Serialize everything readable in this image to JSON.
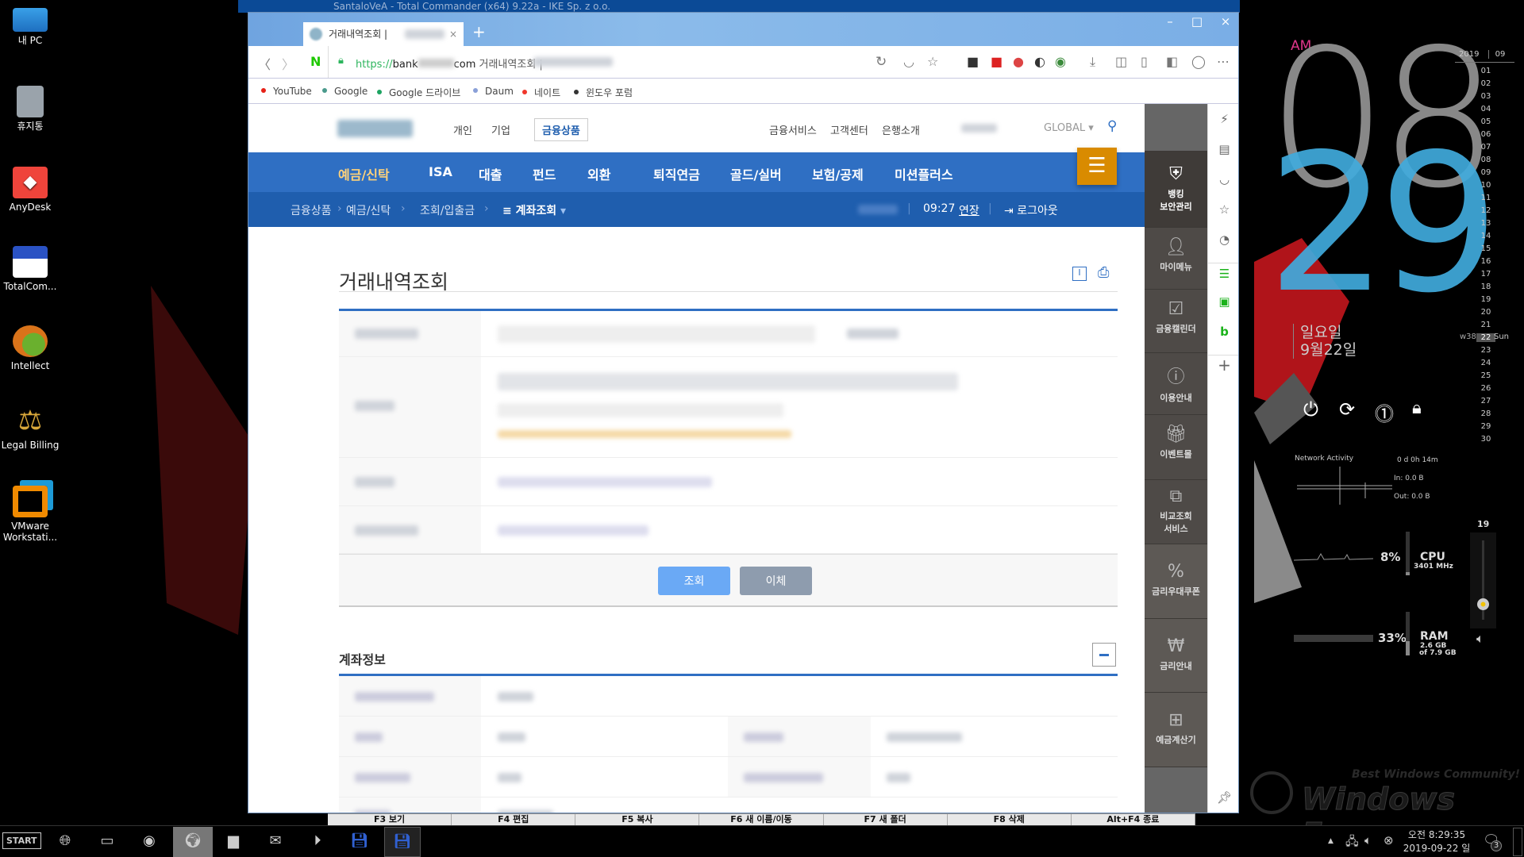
{
  "desktop": {
    "icons": [
      {
        "label": "내 PC",
        "icon": "computer-icon"
      },
      {
        "label": "휴지통",
        "icon": "recycle-bin-icon"
      },
      {
        "label": "AnyDesk",
        "icon": "anydesk-icon"
      },
      {
        "label": "TotalCom...",
        "icon": "floppy-icon"
      },
      {
        "label": "Intellect",
        "icon": "intellect-icon"
      },
      {
        "label": "Legal Billing",
        "icon": "scales-icon"
      },
      {
        "label": "VMware Workstati...",
        "icon": "vmware-icon"
      }
    ]
  },
  "background_window": {
    "title": "SantaloVeA - Total Commander (x64) 9.22a - IKE Sp. z o.o."
  },
  "browser": {
    "tab": {
      "title": "거래내역조회 |",
      "close": "×",
      "new_tab": "+"
    },
    "window_controls": {
      "minimize": "–",
      "maximize": "□",
      "close": "×"
    },
    "address": {
      "scheme": "https://",
      "host_prefix": "bank",
      "host_suffix": "com",
      "page_title": "거래내역조회 |"
    },
    "bookmarks": [
      {
        "label": "YouTube",
        "color": "#e62117"
      },
      {
        "label": "Google",
        "color": "#4a9a8c"
      },
      {
        "label": "Google 드라이브",
        "color": "#1da462"
      },
      {
        "label": "Daum",
        "color": "#8aa0d8"
      },
      {
        "label": "네이트",
        "color": "#f0362b"
      },
      {
        "label": "윈도우 포럼",
        "color": "#333333"
      }
    ]
  },
  "site": {
    "top_links": [
      "개인",
      "기업",
      "금융상품"
    ],
    "util_links": [
      "금융서비스",
      "고객센터",
      "은행소개"
    ],
    "global": "GLOBAL",
    "gnb": [
      "예금/신탁",
      "ISA",
      "대출",
      "펀드",
      "외환",
      "퇴직연금",
      "골드/실버",
      "보험/공제",
      "미션플러스"
    ],
    "breadcrumb": [
      "금융상품",
      "예금/신탁",
      "조회/입출금",
      "계좌조회"
    ],
    "session_time": "09:27",
    "extend": "연장",
    "logout": "로그아웃",
    "page_title": "거래내역조회",
    "buttons": {
      "search": "조회",
      "transfer": "이체"
    },
    "section_title": "계좌정보",
    "colors": {
      "gnb": "#2f6fc3",
      "breadcrumb": "#1f5eae",
      "active": "#ffd27a",
      "menu": "#d98b00"
    }
  },
  "side_menu": [
    {
      "label": "뱅킹\n보안관리",
      "icon": "shield-icon"
    },
    {
      "label": "마이메뉴",
      "icon": "user-icon"
    },
    {
      "label": "금융캘린더",
      "icon": "calendar-icon"
    },
    {
      "label": "이용안내",
      "icon": "info-icon"
    },
    {
      "label": "이벤트몰",
      "icon": "gift-icon"
    },
    {
      "label": "비교조회\n서비스",
      "icon": "compare-icon"
    },
    {
      "label": "금리우대쿠폰",
      "icon": "coupon-icon"
    },
    {
      "label": "금리안내",
      "icon": "won-icon"
    },
    {
      "label": "예금계산기",
      "icon": "calculator-icon"
    }
  ],
  "fkeys": [
    "F3 보기",
    "F4 편집",
    "F5 복사",
    "F6 새 이름/이동",
    "F7 새 폴더",
    "F8 삭제",
    "Alt+F4 종료"
  ],
  "clock_widget": {
    "ampm": "AM",
    "hour": "08",
    "minute": "29",
    "weekday": "일요일",
    "date": "9월22일"
  },
  "calendar": {
    "year": "2019",
    "month": "09",
    "days": [
      "01",
      "02",
      "03",
      "04",
      "05",
      "06",
      "07",
      "08",
      "09",
      "10",
      "11",
      "12",
      "13",
      "14",
      "15",
      "16",
      "17",
      "18",
      "19",
      "20",
      "21",
      "22",
      "23",
      "24",
      "25",
      "26",
      "27",
      "28",
      "29",
      "30"
    ],
    "week": "w38",
    "today": "22",
    "today_name": "Sun"
  },
  "network": {
    "title": "Network Activity",
    "uptime": "0 d 0h 14m",
    "in": "In: 0.0 B",
    "out": "Out: 0.0 B"
  },
  "cpu": {
    "percent": "8%",
    "label": "CPU",
    "freq": "3401 MHz",
    "level": 0.08
  },
  "ram": {
    "percent": "33%",
    "label": "RAM",
    "used": "2.6 GB",
    "total": "of 7.9 GB",
    "level": 0.33
  },
  "volume": {
    "value": "19",
    "level": 0.19
  },
  "watermark": {
    "tagline": "Best Windows Community!",
    "name": "Windows Forum"
  },
  "taskbar": {
    "start": "START",
    "clock_time": "오전 8:29:35",
    "clock_date": "2019-09-22 일",
    "notifications": "3"
  }
}
